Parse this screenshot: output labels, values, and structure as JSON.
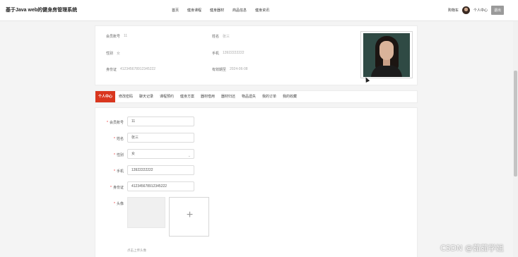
{
  "header": {
    "site_title": "基于Java web的健身房管理系统",
    "nav": [
      "首页",
      "健身课程",
      "健身器材",
      "商品信息",
      "健身资讯"
    ],
    "cart": "购物车",
    "user_center": "个人中心",
    "logout": "退出"
  },
  "info": {
    "member_no_label": "会员账号",
    "member_no_value": "11",
    "name_label": "姓名",
    "name_value": "张三",
    "gender_label": "性别",
    "gender_value": "女",
    "phone_label": "手机",
    "phone_value": "13922222222",
    "id_label": "身份证",
    "id_value": "412345678912345222",
    "valid_label": "有效期至",
    "valid_value": "2024-06-08"
  },
  "tabs": [
    "个人中心",
    "修改密码",
    "聊天记录",
    "课程预约",
    "健身方案",
    "器材借用",
    "器材归还",
    "物品遗失",
    "我的订单",
    "我的收藏"
  ],
  "form": {
    "member_no_label": "会员账号",
    "member_no_value": "11",
    "name_label": "姓名",
    "name_value": "张三",
    "gender_label": "性别",
    "gender_value": "女",
    "phone_label": "手机",
    "phone_value": "13922222222",
    "id_label": "身份证",
    "id_value": "412345678912345222",
    "avatar_label": "头像",
    "upload_hint": "点击上传头像"
  },
  "watermark": "CSDN @茹茹学姐"
}
